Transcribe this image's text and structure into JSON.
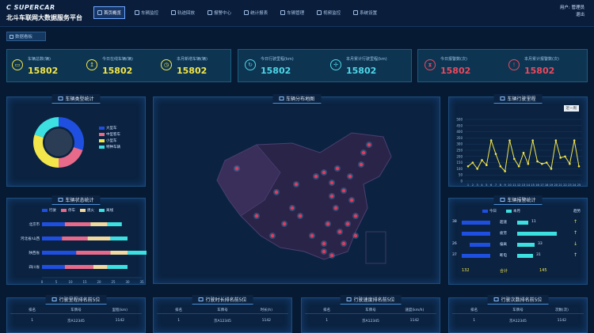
{
  "header": {
    "logo": "C SUPERCAR",
    "title": "北斗车联网大数据服务平台",
    "nav": [
      {
        "label": "首页概览",
        "active": true
      },
      {
        "label": "车辆监控",
        "active": false
      },
      {
        "label": "轨迹回放",
        "active": false
      },
      {
        "label": "报警中心",
        "active": false
      },
      {
        "label": "统计报表",
        "active": false
      },
      {
        "label": "车辆管理",
        "active": false
      },
      {
        "label": "视频监控",
        "active": false
      },
      {
        "label": "系统设置",
        "active": false
      }
    ],
    "user_line1": "用户: 管理员",
    "user_line2": "退出"
  },
  "breadcrumb": "数据看板",
  "kpis": [
    {
      "label": "车辆总数(辆)",
      "value": "15802",
      "color": "#f3e64a",
      "icon": "car-icon"
    },
    {
      "label": "今日在线车辆(辆)",
      "value": "15802",
      "color": "#f3e64a",
      "icon": "upload-icon"
    },
    {
      "label": "本月新增车辆(辆)",
      "value": "15802",
      "color": "#f3e64a",
      "icon": "clock-icon"
    },
    {
      "label": "今日行驶里程(km)",
      "value": "15802",
      "color": "#4fd6e8",
      "icon": "refresh-icon"
    },
    {
      "label": "本月累计行驶里程(km)",
      "value": "15802",
      "color": "#4fd6e8",
      "icon": "compass-icon"
    },
    {
      "label": "今日报警数(次)",
      "value": "15802",
      "color": "#e84a5f",
      "icon": "hourglass-icon"
    },
    {
      "label": "本月累计报警数(次)",
      "value": "15802",
      "color": "#e84a5f",
      "icon": "alarm-icon"
    }
  ],
  "panels": {
    "vehicle_type": {
      "title": "车辆类型统计",
      "legend": [
        {
          "label": "大型车",
          "color": "#1f4fe0"
        },
        {
          "label": "中型客车",
          "color": "#e86a8a"
        },
        {
          "label": "小型车",
          "color": "#f3e64a"
        },
        {
          "label": "特种车辆",
          "color": "#3de0e0"
        }
      ]
    },
    "distribution": {
      "title": "车辆分布地图"
    },
    "trend": {
      "title": "车辆行驶里程",
      "select": "近一周"
    },
    "status": {
      "title": "车辆状态统计",
      "legend": [
        {
          "label": "行驶",
          "color": "#1f4fe0"
        },
        {
          "label": "停车",
          "color": "#e86a8a"
        },
        {
          "label": "熄火",
          "color": "#f1d9a0"
        },
        {
          "label": "离线",
          "color": "#3de0e0"
        }
      ],
      "rows": [
        "北京市",
        "河北省/山西",
        "陕西省",
        "四川省"
      ]
    },
    "alarm": {
      "title": "车辆报警统计",
      "col_left": "今日",
      "col_right": "本月",
      "col_status": "趋势",
      "rows": [
        {
          "left": "38",
          "label": "超速",
          "right": "11",
          "trend": "↑"
        },
        {
          "left": "",
          "label": "疲劳",
          "right": "",
          "trend": "↑"
        },
        {
          "left": "26",
          "label": "偏离",
          "right": "33",
          "trend": "↓"
        },
        {
          "left": "37",
          "label": "断电",
          "right": "31",
          "trend": "↑"
        }
      ],
      "footer_left": "132",
      "footer_mid": "合计",
      "footer_right": "145"
    },
    "rank1": {
      "title": "行驶里程排名前5位",
      "head": [
        "排名",
        "车牌号",
        "里程(km)"
      ],
      "row": [
        "1",
        "京A12345",
        "1142"
      ]
    },
    "rank2": {
      "title": "行驶时长排名前5位",
      "head": [
        "排名",
        "车牌号",
        "时长(h)"
      ],
      "row": [
        "1",
        "京A12345",
        "1142"
      ]
    },
    "rank3": {
      "title": "行驶速度排名前5位",
      "head": [
        "排名",
        "车牌号",
        "速度(km/h)"
      ],
      "row": [
        "1",
        "京A12345",
        "1142"
      ]
    },
    "rank4": {
      "title": "行驶次数排名前5位",
      "head": [
        "排名",
        "车牌号",
        "次数(次)"
      ],
      "row": [
        "1",
        "京A12345",
        "1142"
      ]
    }
  },
  "chart_data": [
    {
      "type": "pie",
      "categories": [
        "大型车",
        "中型客车",
        "小型车",
        "特种车辆"
      ],
      "values": [
        30,
        20,
        30,
        20
      ]
    },
    {
      "type": "line",
      "x": [
        "1",
        "2",
        "3",
        "4",
        "5",
        "6",
        "7",
        "8",
        "9",
        "10",
        "11",
        "12",
        "13",
        "14",
        "15",
        "16",
        "17",
        "18",
        "19",
        "20",
        "21",
        "22",
        "23",
        "24",
        "25"
      ],
      "values": [
        120,
        150,
        100,
        170,
        130,
        330,
        220,
        120,
        80,
        330,
        180,
        120,
        230,
        140,
        330,
        160,
        140,
        150,
        100,
        330,
        190,
        200,
        140,
        330,
        120
      ],
      "ylim": [
        0,
        500
      ],
      "yticks": [
        "0",
        "50",
        "100",
        "150",
        "200",
        "250",
        "300",
        "350",
        "400",
        "450",
        "500"
      ]
    },
    {
      "type": "bar",
      "categories": [
        "北京市",
        "河北省/山西",
        "陕西省",
        "四川省"
      ],
      "series": [
        {
          "name": "行驶",
          "values": [
            8,
            7,
            12,
            8
          ]
        },
        {
          "name": "停车",
          "values": [
            9,
            9,
            12,
            10
          ]
        },
        {
          "name": "熄火",
          "values": [
            6,
            8,
            6,
            5
          ]
        },
        {
          "name": "离线",
          "values": [
            5,
            6,
            13,
            7
          ]
        }
      ],
      "xticks": [
        "0",
        "5",
        "10",
        "15",
        "20",
        "25",
        "30",
        "35"
      ],
      "xlim": [
        0,
        35
      ]
    }
  ],
  "colors": {
    "accent": "#4a8fd6",
    "yellow": "#f3e64a",
    "cyan": "#4fd6e8",
    "red": "#e84a5f"
  }
}
